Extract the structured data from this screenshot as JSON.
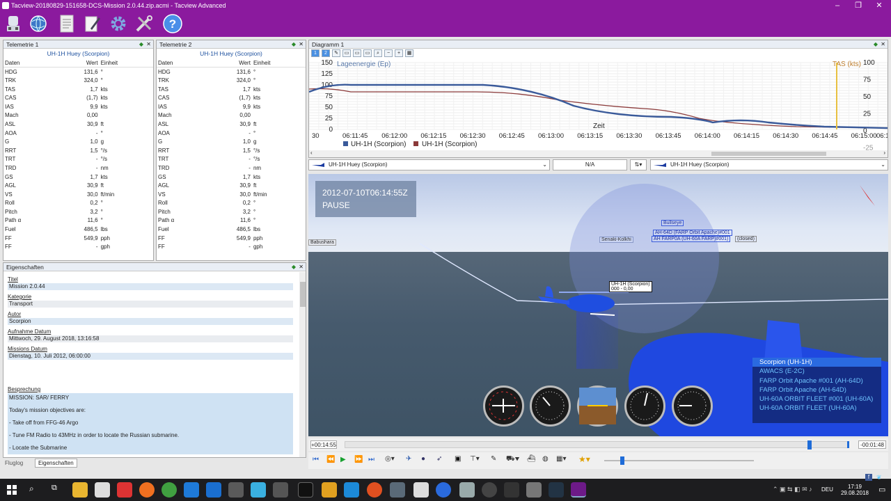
{
  "window": {
    "title": "Tacview-20180829-151658-DCS-Mission 2.0.44.zip.acmi - Tacview Advanced"
  },
  "toolbar": {
    "icons": [
      "flight-recorder-icon",
      "globe-icon",
      "document-icon",
      "notepad-icon",
      "gear-icon",
      "tools-icon",
      "help-icon"
    ],
    "help_glyph": "?"
  },
  "tel1": {
    "title": "Telemetrie 1",
    "object": "UH-1H Huey (Scorpion)"
  },
  "tel2": {
    "title": "Telemetrie 2",
    "object": "UH-1H Huey (Scorpion)"
  },
  "telemetry_headers": [
    "Daten",
    "Wert",
    "Einheit"
  ],
  "telemetry_rows": [
    [
      "HDG",
      "131,6",
      "°"
    ],
    [
      "TRK",
      "324,0",
      "°"
    ],
    [
      "TAS",
      "1,7",
      "kts"
    ],
    [
      "CAS",
      "(1,7)",
      "kts"
    ],
    [
      "IAS",
      "9,9",
      "kts"
    ],
    [
      "Mach",
      "0,00",
      ""
    ],
    [
      "ASL",
      "30,9",
      "ft"
    ],
    [
      "AOA",
      "-",
      "°"
    ],
    [
      "G",
      "1,0",
      "g"
    ],
    [
      "RRT",
      "1,5",
      "°/s"
    ],
    [
      "TRT",
      "-",
      "°/s"
    ],
    [
      "TRD",
      "-",
      "nm"
    ],
    [
      "GS",
      "1,7",
      "kts"
    ],
    [
      "AGL",
      "30,9",
      "ft"
    ],
    [
      "VS",
      "30,0",
      "ft/min"
    ],
    [
      "Roll",
      "0,2",
      "°"
    ],
    [
      "Pitch",
      "3,2",
      "°"
    ],
    [
      "Path α",
      "11,6",
      "°"
    ],
    [
      "Fuel",
      "486,5",
      "lbs"
    ],
    [
      "FF",
      "549,9",
      "pph"
    ],
    [
      "FF",
      "-",
      "gph"
    ]
  ],
  "props": {
    "title": "Eigenschaften",
    "fields": [
      {
        "label": "Titel",
        "value": "Mission 2.0.44"
      },
      {
        "label": "Kategorie",
        "value": "Transport"
      },
      {
        "label": "Autor",
        "value": "Scorpion"
      },
      {
        "label": "Aufnahme Datum",
        "value": "Mittwoch, 29. August 2018, 13:16:58"
      },
      {
        "label": "Missions Datum",
        "value": "Dienstag, 10. Juli 2012, 06:00:00"
      }
    ],
    "briefing_label": "Besprechung",
    "briefing": [
      "MISSION: SAR/ FERRY",
      "Today's mission objectives are:",
      "- Take off from FFG-46 Argo",
      "- Tune FM Radio to 43MHz in order to locate the Russian submarine.",
      "- Locate the Submarine"
    ]
  },
  "bottom_tabs": [
    "Fluglog",
    "Eigenschaften"
  ],
  "diagram": {
    "title": "Diagramm 1",
    "left_label": "Lageenergie (Ep)",
    "right_label": "TAS (kts)",
    "left_ticks": [
      "150",
      "125",
      "100",
      "75",
      "50",
      "25",
      "0"
    ],
    "right_ticks": [
      "100",
      "75",
      "50",
      "25",
      "0",
      "-25"
    ],
    "x_ticks": [
      "30",
      "06:11:45",
      "06:12:00",
      "06:12:15",
      "06:12:30",
      "06:12:45",
      "06:13:00",
      "06:13:15",
      "06:13:30",
      "06:13:45",
      "06:14:00",
      "06:14:15",
      "06:14:30",
      "06:14:45",
      "06:15:00",
      "06:15"
    ],
    "xlabel": "Zeit",
    "legend": [
      "UH-1H (Scorpion)",
      "UH-1H (Scorpion)"
    ],
    "colors": {
      "blue": "#3a5a9a",
      "red": "#8b3a3a",
      "cursor": "#e8c040"
    }
  },
  "selectors": {
    "left": "UH-1H Huey (Scorpion)",
    "mid": "N/A",
    "right": "UH-1H Huey (Scorpion)"
  },
  "scene": {
    "timestamp": "2012-07-10T06:14:55Z",
    "status": "PAUSE",
    "labels": {
      "bullseye": "Bullseye",
      "senaki": "Senaki-Kolkhi",
      "babushara": "Babushara",
      "ah64": "AH-64D (FARP Orbit Apache)#001",
      "ah60": "AH FARP0A (UH-60A FARP)#001)",
      "closed": "(closed)",
      "heli1": "UH-1H (Scorpion)",
      "heli2": "000 - 0,00"
    },
    "object_list": [
      "Scorpion (UH-1H)",
      "AWACS (E-2C)",
      "FARP Orbit Apache #001 (AH-64D)",
      "FARP Orbit Apache (AH-64D)",
      "UH-60A ORBIT FLEET #001 (UH-60A)",
      "UH-60A ORBIT FLEET (UH-60A)"
    ]
  },
  "timeline": {
    "left": "+00:14:55",
    "right": "-00:01:48",
    "progress": 0.92
  },
  "tray": {
    "lang": "DEU",
    "time": "17:19",
    "date": "29.08.2018"
  }
}
